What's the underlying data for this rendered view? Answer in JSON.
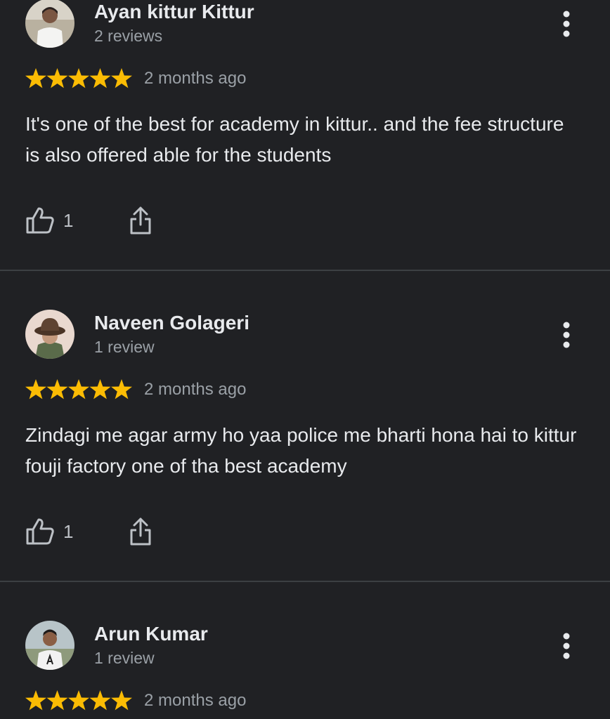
{
  "colors": {
    "background": "#202124",
    "star": "#fbbc04",
    "text_primary": "#e8eaed",
    "text_secondary": "#9aa0a6",
    "divider": "#3c4043"
  },
  "reviews": [
    {
      "author": "Ayan kittur Kittur",
      "review_count": "2 reviews",
      "rating": 5,
      "time": "2 months ago",
      "text": "It's one of the best for academy in kittur.. and the fee structure is also offered able for the students",
      "likes": "1",
      "avatar_icon": "avatar-photo"
    },
    {
      "author": "Naveen Golageri",
      "review_count": "1 review",
      "rating": 5,
      "time": "2 months ago",
      "text": "Zindagi me agar army ho yaa police me bharti hona hai to kittur fouji factory one of tha best academy",
      "likes": "1",
      "avatar_icon": "avatar-photo"
    },
    {
      "author": "Arun Kumar",
      "review_count": "1 review",
      "rating": 5,
      "time": "2 months ago",
      "avatar_icon": "avatar-photo"
    }
  ]
}
